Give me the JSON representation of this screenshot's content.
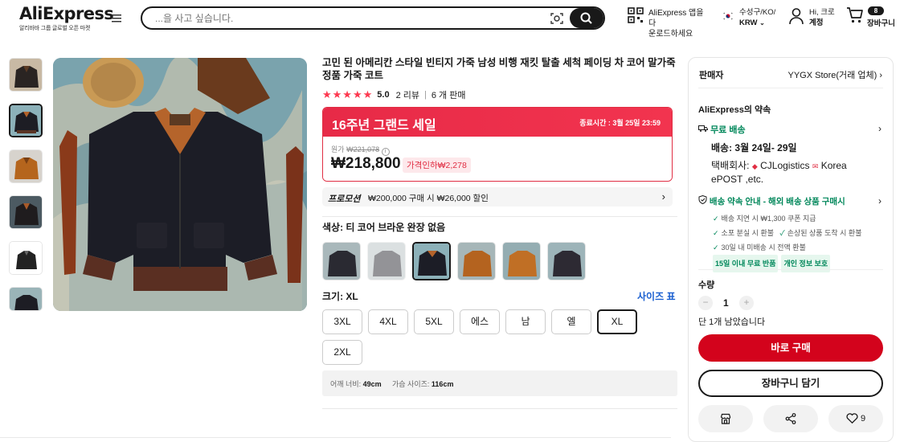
{
  "header": {
    "logo": "AliExpress",
    "logo_sub": "알리바바 그룹 글로벌 오픈 마켓",
    "menu_icon": "menu-icon",
    "search_placeholder": "...을 사고 싶습니다.",
    "app_line1": "AliExpress 앱을 다",
    "app_line2": "운로드하세요",
    "loc_line1": "수성구/KO/",
    "loc_line2": "KRW",
    "account_line1": "Hi, 크로",
    "account_line2": "계정",
    "cart_count": "8",
    "cart_label": "장바구니"
  },
  "product": {
    "title": "고민 된 아메리칸 스타일 빈티지 가죽 남성 비행 재킷 탈출 세척 페이딩 차 코어 말가죽 정품 가죽 코트",
    "rating": "5.0",
    "reviews": "2 리뷰",
    "sold": "6 개 판매",
    "sale_title": "16주년 그랜드 세일",
    "sale_end_label": "종료시간 :",
    "sale_end": "3월 25일 23:59",
    "orig_label": "원가",
    "orig_price": "₩221,078",
    "price": "₩218,800",
    "discount": "가격인하₩2,278",
    "promo_label": "프로모션",
    "promo_text": "₩200,000 구매 시 ₩26,000 할인",
    "color_label": "색상: 티 코어 브라운 완장 없음",
    "size_label": "크기: XL",
    "size_chart": "사이즈 표",
    "sizes": [
      "3XL",
      "4XL",
      "5XL",
      "에스",
      "남",
      "엘",
      "XL",
      "2XL"
    ],
    "selected_size": "XL",
    "measure_shoulder_label": "어깨 너비:",
    "measure_shoulder": "49cm",
    "measure_chest_label": "가슴 사이즈:",
    "measure_chest": "116cm"
  },
  "panel": {
    "seller_label": "판매자",
    "seller_name": "YYGX Store(거래 업체)",
    "promise_title": "AliExpress의 약속",
    "free_shipping": "무료 배송",
    "delivery": "배송: 3월 24일- 29일",
    "courier_label": "택배회사:",
    "courier_text": "CJLogistics",
    "courier_text2": "Korea",
    "courier_text3": "ePOST ,etc.",
    "guarantee_title": "배송 약속 안내 - 해외 배송 상품 구매시",
    "g1": "배송 지연 시 ₩1,300 쿠폰 지급",
    "g2": "소포 분실 시 환불",
    "g3": "손상된 상품 도착 시 환불",
    "g4": "30일 내 미배송 시 전액 환불",
    "tag1": "15일 이내 무료 반품",
    "tag2": "개인 정보 보호",
    "qty_label": "수량",
    "qty": "1",
    "stock": "단 1개 남았습니다",
    "buy_now": "바로 구매",
    "add_cart": "장바구니 담기",
    "wish_count": "9"
  },
  "colors": {
    "accent": "#d3031c",
    "sale": "#e72a47",
    "green": "#00875a",
    "link": "#1a5fd0"
  }
}
